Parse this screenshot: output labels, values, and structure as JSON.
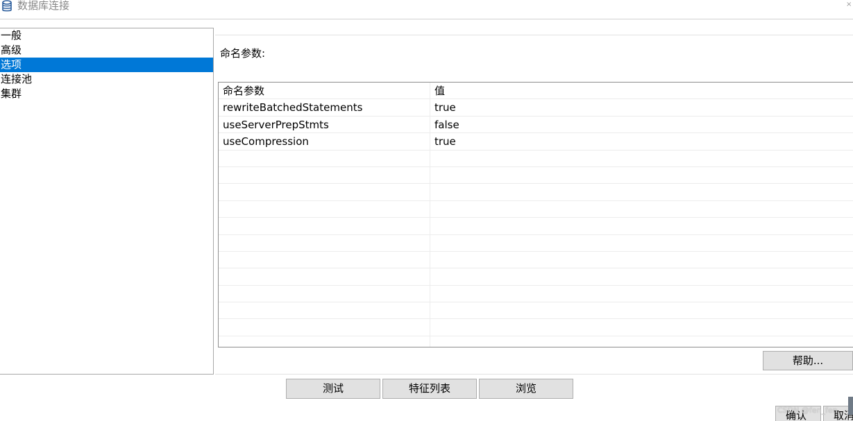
{
  "window": {
    "title": "数据库连接",
    "icon": "database-icon",
    "close_icon": "close-icon"
  },
  "nav": {
    "items": [
      {
        "label": "一般",
        "selected": false
      },
      {
        "label": "高级",
        "selected": false
      },
      {
        "label": "选项",
        "selected": true
      },
      {
        "label": "连接池",
        "selected": false
      },
      {
        "label": "集群",
        "selected": false
      }
    ]
  },
  "options": {
    "section_label": "命名参数:",
    "table": {
      "headers": [
        "命名参数",
        "值"
      ],
      "rows": [
        [
          "rewriteBatchedStatements",
          "true"
        ],
        [
          "useServerPrepStmts",
          "false"
        ],
        [
          "useCompression",
          "true"
        ]
      ]
    },
    "help_label": "帮助..."
  },
  "bottom": {
    "test_label": "测试",
    "features_label": "特征列表",
    "browse_label": "浏览",
    "ok_label": "确认",
    "cancel_label": "取消"
  },
  "watermark": "CSDN @fen_fen",
  "colors": {
    "selection": "#0078d7",
    "button_bg": "#e1e1e1",
    "border": "#a8a8a8"
  }
}
